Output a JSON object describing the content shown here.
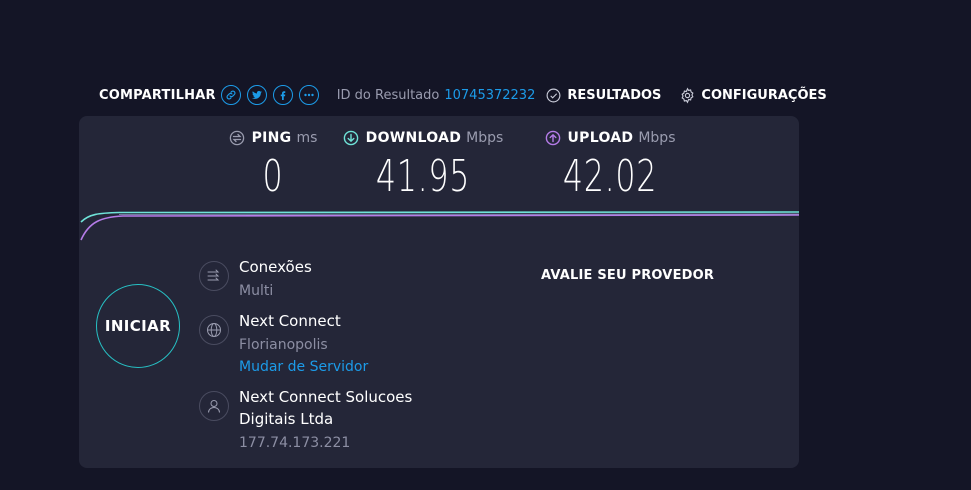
{
  "share": {
    "label": "COMPARTILHAR",
    "icons": [
      "link-icon",
      "twitter-icon",
      "facebook-icon",
      "more-icon"
    ]
  },
  "result": {
    "label": "ID do Resultado",
    "value": "10745372232"
  },
  "nav": {
    "results_label": "RESULTADOS",
    "settings_label": "CONFIGURAÇÕES"
  },
  "metrics": {
    "ping": {
      "name": "PING",
      "unit": "ms",
      "value": "0"
    },
    "download": {
      "name": "DOWNLOAD",
      "unit": "Mbps",
      "value": "41.95"
    },
    "upload": {
      "name": "UPLOAD",
      "unit": "Mbps",
      "value": "42.02"
    }
  },
  "start_label": "INICIAR",
  "connections": {
    "title": "Conexões",
    "value": "Multi"
  },
  "server": {
    "name": "Next Connect",
    "location": "Florianopolis",
    "change_label": "Mudar de Servidor"
  },
  "provider": {
    "name": "Next Connect Solucoes Digitais Ltda",
    "ip": "177.74.173.221"
  },
  "rate_label": "AVALIE SEU PROVEDOR",
  "colors": {
    "accent_blue": "#1c9be8",
    "download_teal": "#6fe3d8",
    "upload_purple": "#b57ce8",
    "start_ring": "#27c0c4",
    "panel_bg": "#242638",
    "page_bg": "#141526"
  }
}
